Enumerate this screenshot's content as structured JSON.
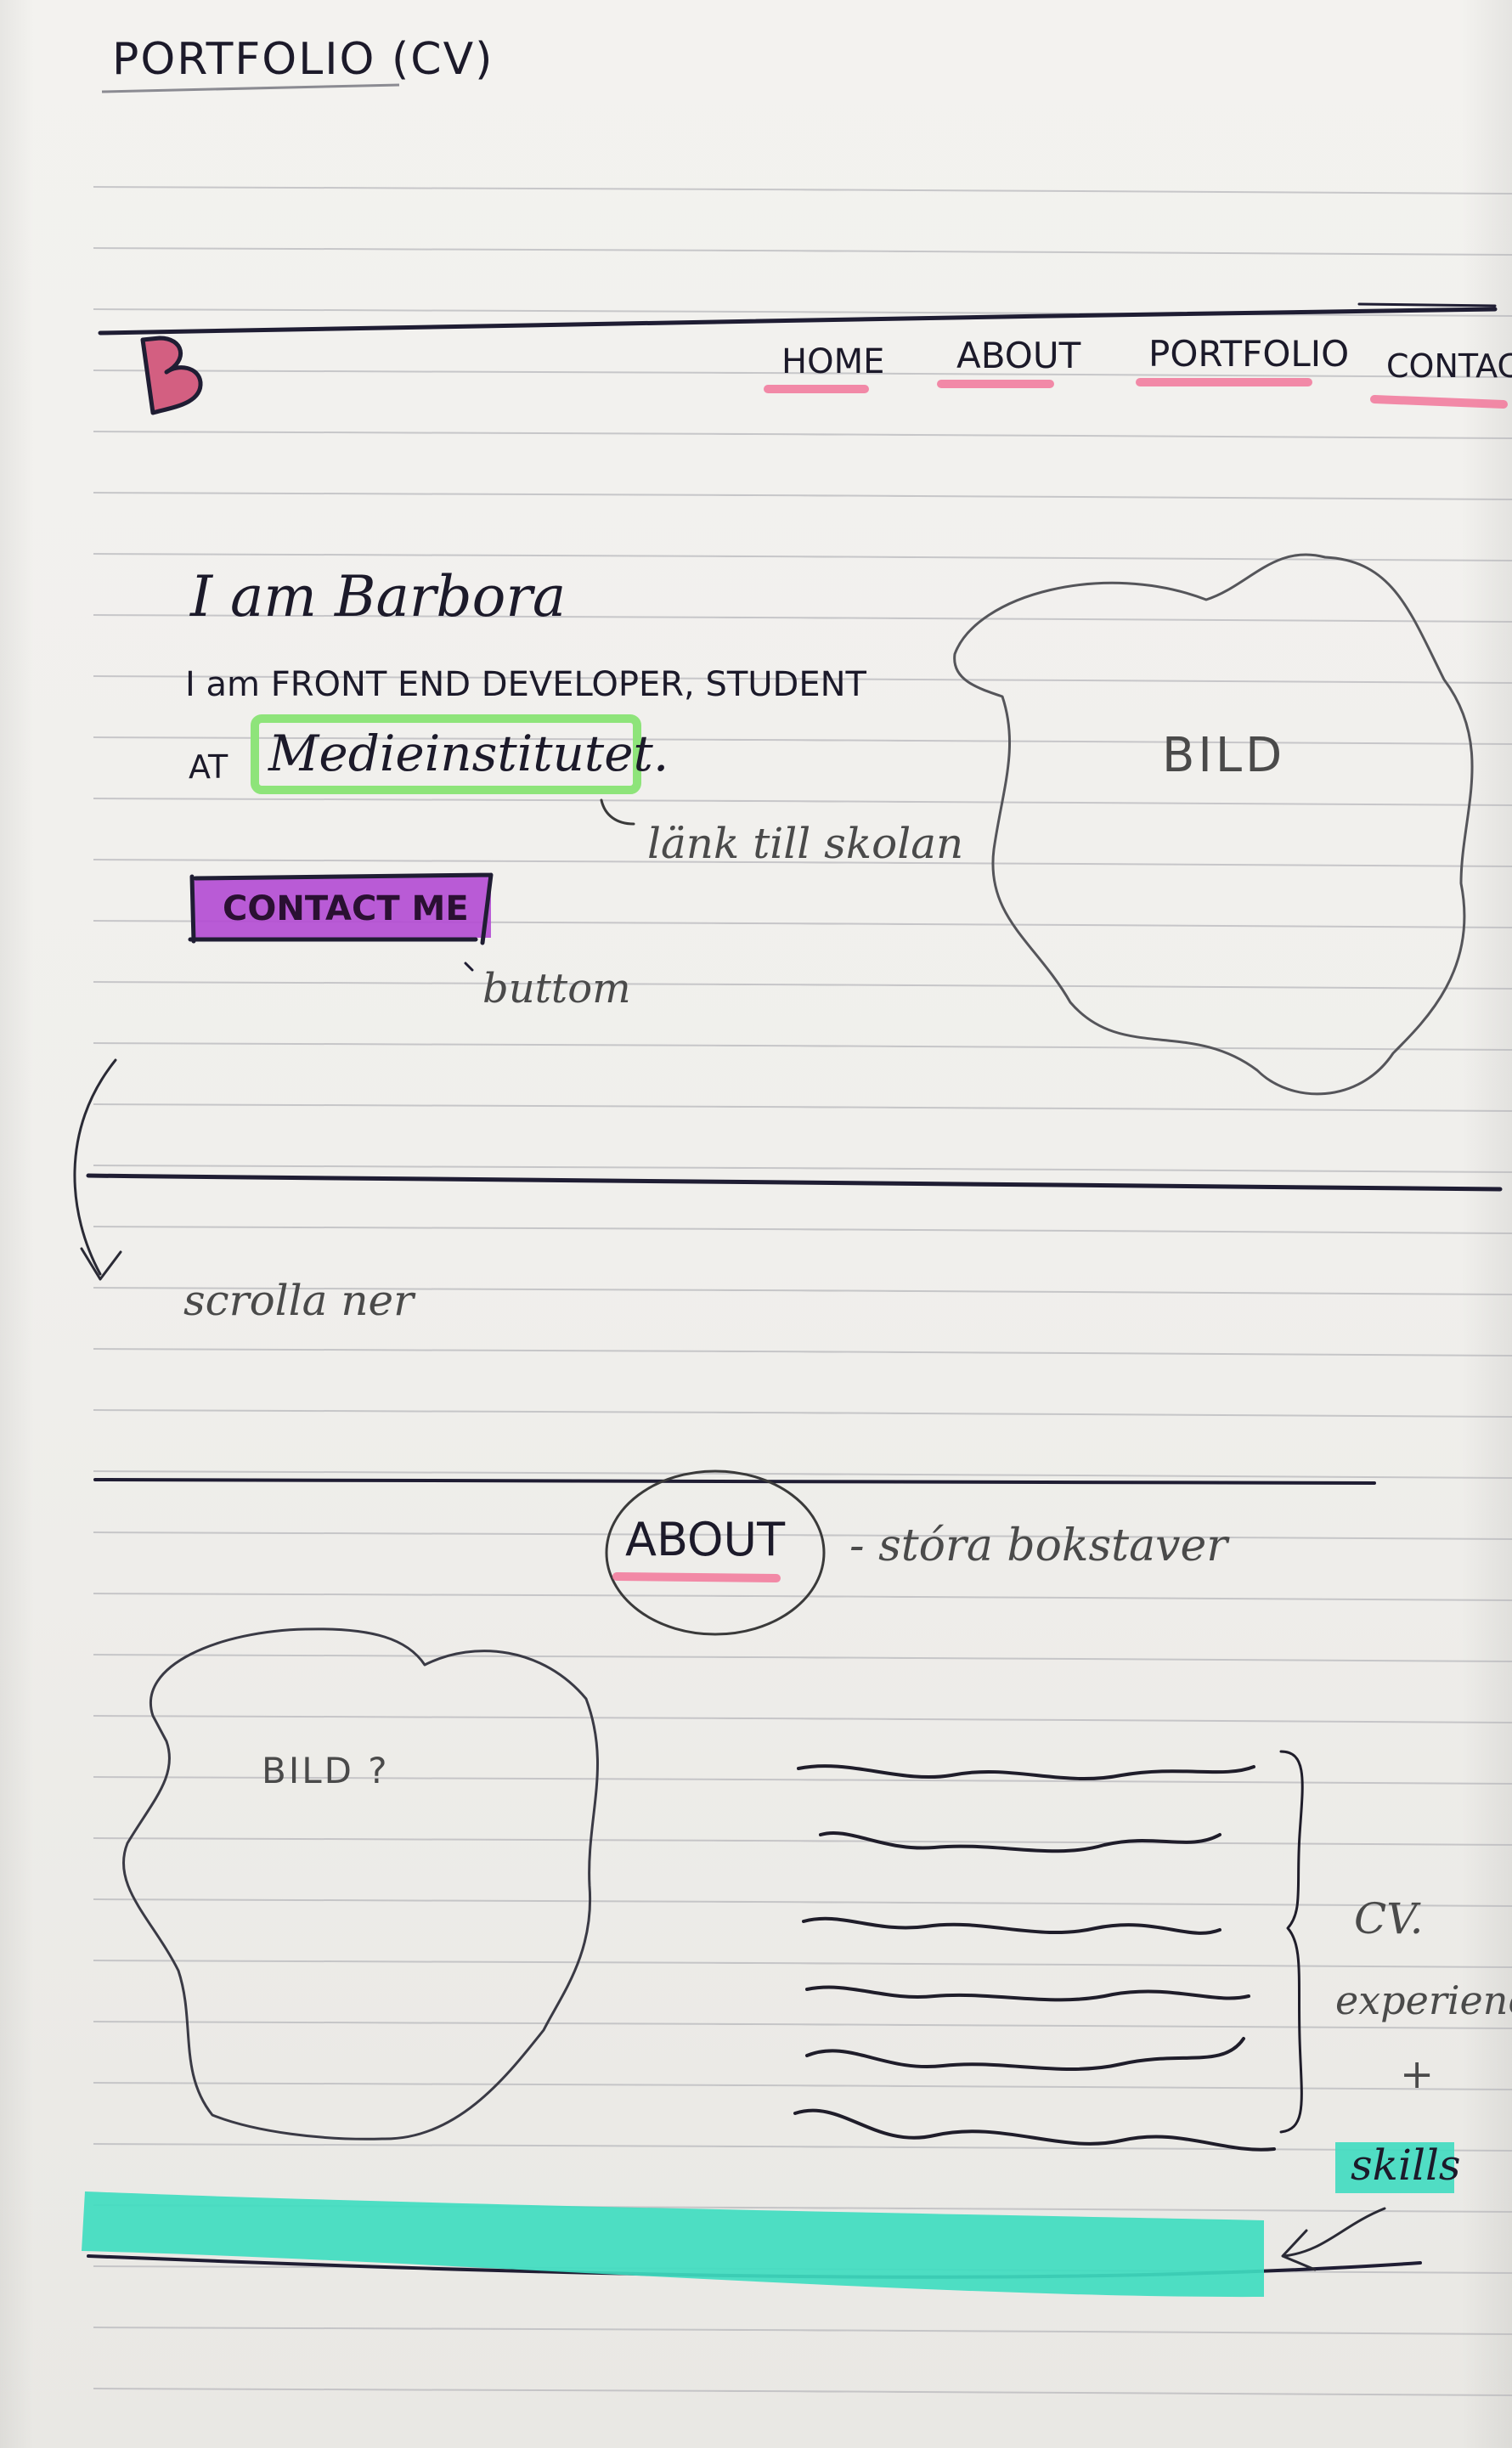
{
  "sketch_title": "PORTFOLIO (CV)",
  "header": {
    "logo": "B",
    "nav": [
      {
        "label": "HOME",
        "underline_color": "#f2779a"
      },
      {
        "label": "ABOUT",
        "underline_color": "#f2779a"
      },
      {
        "label": "PORTFOLIO",
        "underline_color": "#f2779a"
      },
      {
        "label": "CONTAC",
        "underline_color": "#f2779a"
      }
    ]
  },
  "hero": {
    "greeting": "I am Barbora",
    "intro_line1": "I am FRONT END DEVELOPER, STUDENT",
    "intro_prefix": "AT",
    "school_link": "Medieinstitutet.",
    "link_note": "länk till skolan",
    "cta_label": "CONTACT ME",
    "cta_note": "buttom",
    "image_label": "BILD",
    "link_highlight_color": "#8ee47a",
    "cta_color": "#b34ad3"
  },
  "scroll_note": "scrolla ner",
  "about": {
    "heading": "ABOUT",
    "heading_note": "- stóra bokstaver",
    "image_label": "BILD ?",
    "side_note_line1": "CV.",
    "side_note_line2": "experience",
    "side_note_line3": "+",
    "side_note_line4": "skills",
    "skills_color": "#3fdcc0"
  },
  "icons": {
    "scroll_arrow": "curved-down-arrow-icon",
    "skills_arrow": "left-arrow-icon",
    "brace": "right-brace-icon"
  }
}
